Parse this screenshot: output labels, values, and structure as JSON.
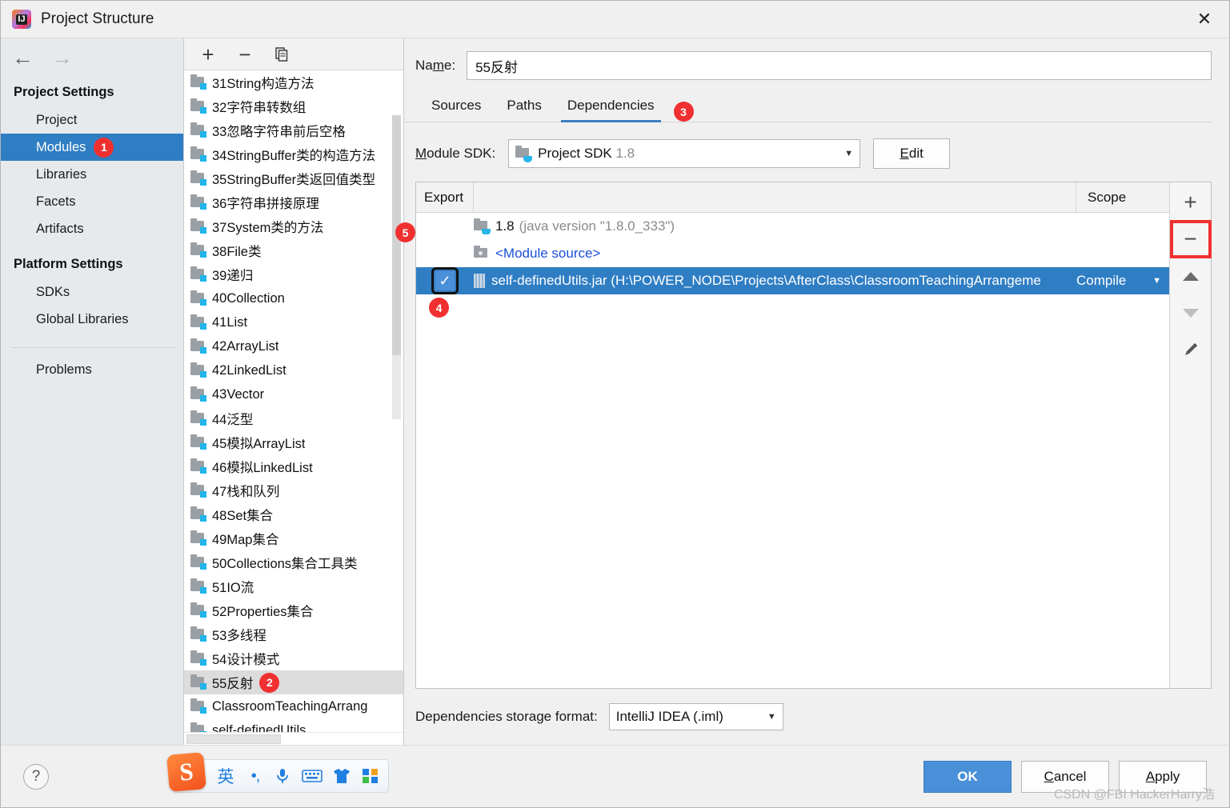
{
  "window": {
    "title": "Project Structure",
    "close_label": "✕",
    "app_icon": "intellij-idea-icon"
  },
  "sidebar": {
    "nav": {
      "back": "←",
      "forward": "→"
    },
    "groups": [
      {
        "title": "Project Settings",
        "items": [
          {
            "label": "Project",
            "selected": false
          },
          {
            "label": "Modules",
            "selected": true,
            "badge": "1"
          },
          {
            "label": "Libraries",
            "selected": false
          },
          {
            "label": "Facets",
            "selected": false
          },
          {
            "label": "Artifacts",
            "selected": false
          }
        ]
      },
      {
        "title": "Platform Settings",
        "items": [
          {
            "label": "SDKs",
            "selected": false
          },
          {
            "label": "Global Libraries",
            "selected": false
          }
        ]
      }
    ],
    "problems_label": "Problems"
  },
  "modules_panel": {
    "toolbar": {
      "add_label": "+",
      "remove_label": "−",
      "copy_label": "copy-icon"
    },
    "items": [
      {
        "label": "31String构造方法"
      },
      {
        "label": "32字符串转数组"
      },
      {
        "label": "33忽略字符串前后空格"
      },
      {
        "label": "34StringBuffer类的构造方法"
      },
      {
        "label": "35StringBuffer类返回值类型"
      },
      {
        "label": "36字符串拼接原理"
      },
      {
        "label": "37System类的方法"
      },
      {
        "label": "38File类"
      },
      {
        "label": "39递归"
      },
      {
        "label": "40Collection"
      },
      {
        "label": "41List"
      },
      {
        "label": "42ArrayList"
      },
      {
        "label": "42LinkedList"
      },
      {
        "label": "43Vector"
      },
      {
        "label": "44泛型"
      },
      {
        "label": "45模拟ArrayList"
      },
      {
        "label": "46模拟LinkedList"
      },
      {
        "label": "47栈和队列"
      },
      {
        "label": "48Set集合"
      },
      {
        "label": "49Map集合"
      },
      {
        "label": "50Collections集合工具类"
      },
      {
        "label": "51IO流"
      },
      {
        "label": "52Properties集合"
      },
      {
        "label": "53多线程"
      },
      {
        "label": "54设计模式"
      },
      {
        "label": "55反射",
        "selected": true,
        "badge": "2"
      },
      {
        "label": "ClassroomTeachingArrang"
      },
      {
        "label": "self-definedUtils"
      }
    ]
  },
  "detail": {
    "name_label_pre": "Na",
    "name_label_mid": "m",
    "name_label_post": "e:",
    "name_value": "55反射",
    "tabs": [
      {
        "label": "Sources",
        "active": false
      },
      {
        "label": "Paths",
        "active": false
      },
      {
        "label": "Dependencies",
        "active": true,
        "badge": "3"
      }
    ],
    "sdk_label_pre": "M",
    "sdk_label_post": "odule SDK:",
    "sdk_value": "Project SDK",
    "sdk_value_dim": "1.8",
    "sdk_caret": "▼",
    "edit_button_pre": "E",
    "edit_button_post": "dit",
    "table": {
      "headers": {
        "export": "Export",
        "scope": "Scope"
      },
      "rows": [
        {
          "checkbox": "none",
          "icon": "jdk-folder-icon",
          "name": "1.8",
          "name_dim": "(java version \"1.8.0_333\")",
          "scope": "",
          "selected": false
        },
        {
          "checkbox": "none",
          "icon": "module-source-icon",
          "name": "<Module source>",
          "name_dim": "",
          "scope": "",
          "selected": false,
          "link": true
        },
        {
          "checkbox": "checked",
          "icon": "jar-icon",
          "name": "self-definedUtils.jar (H:\\POWER_NODE\\Projects\\AfterClass\\ClassroomTeachingArrangeme",
          "name_dim": "",
          "scope": "Compile",
          "scope_caret": "▼",
          "selected": true,
          "badge": "4"
        }
      ],
      "side_toolbar": {
        "add_label": "+",
        "remove_label": "−",
        "remove_badge": "5",
        "move_up": "move-up-icon",
        "move_down": "move-down-icon",
        "edit": "pencil-edit-icon"
      }
    },
    "storage_label": "Dependencies storage format:",
    "storage_value": "IntelliJ IDEA (.iml)",
    "storage_caret": "▼"
  },
  "footer": {
    "help_label": "?",
    "ok_label": "OK",
    "cancel_label_pre": "C",
    "cancel_label_post": "ancel",
    "apply_label_pre": "A",
    "apply_label_post": "pply",
    "watermark": "CSDN @FBI HackerHarry浩"
  },
  "ime": {
    "logo": "S",
    "items": [
      {
        "name": "language-toggle",
        "glyph": "英"
      },
      {
        "name": "punctuation-toggle",
        "glyph": "•,"
      },
      {
        "name": "voice-input",
        "glyph": "\u0001"
      },
      {
        "name": "soft-keyboard",
        "glyph": "\u0002"
      },
      {
        "name": "skin-settings",
        "glyph": "\u0003"
      },
      {
        "name": "toolbox",
        "glyph": "\u0004"
      }
    ]
  },
  "colors": {
    "accent": "#2f7ec4",
    "badge_red": "#f03030",
    "primary_button": "#4a90d9",
    "link_blue": "#1a4fd6"
  }
}
